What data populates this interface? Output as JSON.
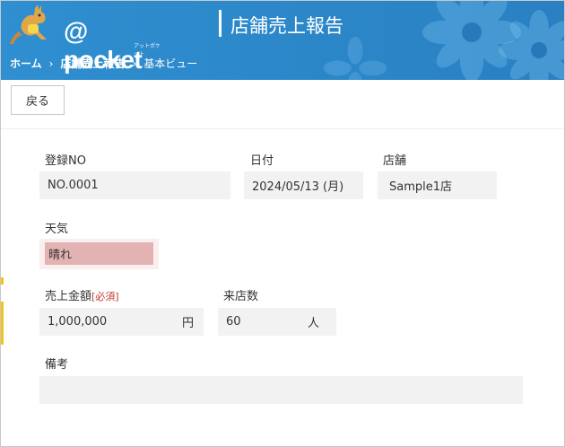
{
  "header": {
    "logo_text": "@ pocket",
    "logo_kana": "アットポケット",
    "title": "店舗売上報告",
    "breadcrumb": [
      "ホーム",
      "店舗売上報告",
      "基本ビュー"
    ],
    "separator": "›"
  },
  "toolbar": {
    "back_label": "戻る"
  },
  "form": {
    "reg_no": {
      "label": "登録NO",
      "value": "NO.0001"
    },
    "date": {
      "label": "日付",
      "value": "2024/05/13 (月)"
    },
    "store": {
      "label": "店舗",
      "value": "Sample1店"
    },
    "weather": {
      "label": "天気",
      "value": "晴れ"
    },
    "sales": {
      "label": "売上金額",
      "required": "[必須]",
      "value": "1,000,000",
      "unit": "円"
    },
    "visitors": {
      "label": "来店数",
      "value": "60",
      "unit": "人"
    },
    "notes": {
      "label": "備考",
      "value": ""
    }
  },
  "colors": {
    "header_blue": "#2b86c8",
    "weather_highlight": "#e3b3b3",
    "required_red": "#c0392b"
  }
}
